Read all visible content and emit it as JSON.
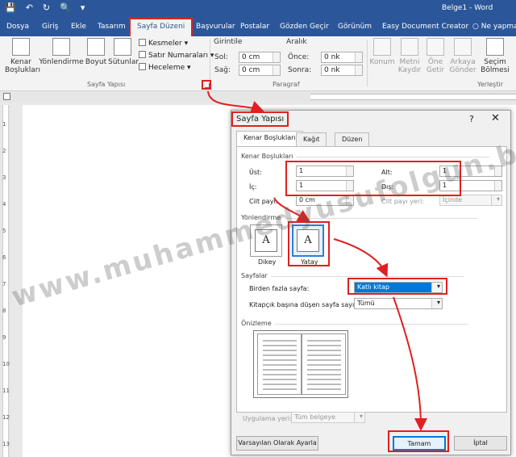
{
  "window": {
    "title": "Belge1 - Word"
  },
  "tabs": [
    "Dosya",
    "Giriş",
    "Ekle",
    "Tasarım",
    "Sayfa Düzeni",
    "Başvurular",
    "Postalar",
    "Gözden Geçir",
    "Görünüm",
    "Easy Document Creator"
  ],
  "active_tab": "Sayfa Düzeni",
  "tell_me": "Ne yapmak",
  "ribbon": {
    "page_setup": {
      "label": "Sayfa Yapısı",
      "margins": "Kenar Boşlukları",
      "orientation": "Yönlendirme",
      "size": "Boyut",
      "columns": "Sütunlar",
      "breaks": "Kesmeler",
      "line_numbers": "Satır Numaraları",
      "hyphenation": "Heceleme"
    },
    "paragraph": {
      "label": "Paragraf",
      "indent": "Girintile",
      "spacing": "Aralık",
      "left_label": "Sol:",
      "left_value": "0 cm",
      "right_label": "Sağ:",
      "right_value": "0 cm",
      "before_label": "Önce:",
      "before_value": "0 nk",
      "after_label": "Sonra:",
      "after_value": "0 nk"
    },
    "arrange": {
      "label": "Yerleştir",
      "position": "Konum",
      "wrap_text": "Metni Kaydır",
      "bring_forward": "Öne Getir",
      "send_backward": "Arkaya Gönder",
      "selection_pane": "Seçim Bölmesi"
    }
  },
  "vertical_ruler": [
    "1",
    "2",
    "3",
    "4",
    "5",
    "6",
    "7",
    "8",
    "9",
    "10",
    "11",
    "12",
    "13"
  ],
  "dialog": {
    "title": "Sayfa Yapısı",
    "help": "?",
    "close": "✕",
    "tabs": [
      "Kenar Boşlukları",
      "Kağıt",
      "Düzen"
    ],
    "margins_section": "Kenar Boşlukları",
    "top_label": "Üst:",
    "top_value": "1",
    "bottom_label": "Alt:",
    "bottom_value": "1",
    "inside_label": "İç:",
    "inside_value": "1",
    "outside_label": "Dış:",
    "outside_value": "1",
    "gutter_label": "Cilt payı:",
    "gutter_value": "0 cm",
    "gutter_pos_label": "Cilt payı yeri:",
    "gutter_pos_value": "İçinde",
    "orientation_section": "Yönlendirme",
    "portrait": "Dikey",
    "landscape": "Yatay",
    "pages_section": "Sayfalar",
    "multiple_pages_label": "Birden fazla sayfa:",
    "multiple_pages_value": "Katlı kitap",
    "sheets_label": "Kitapçık başına düşen sayfa sayısı:",
    "sheets_value": "Tümü",
    "preview_section": "Önizleme",
    "apply_to_label": "Uygulama yeri:",
    "apply_to_value": "Tüm belgeye",
    "set_default": "Varsayılan Olarak Ayarla",
    "ok": "Tamam",
    "cancel": "İptal"
  },
  "watermark": "www.muhammedyusufolgun.blogspot.com",
  "colors": {
    "titlebar": "#2b579a",
    "highlight": "#e02020",
    "selection": "#0078d7"
  }
}
